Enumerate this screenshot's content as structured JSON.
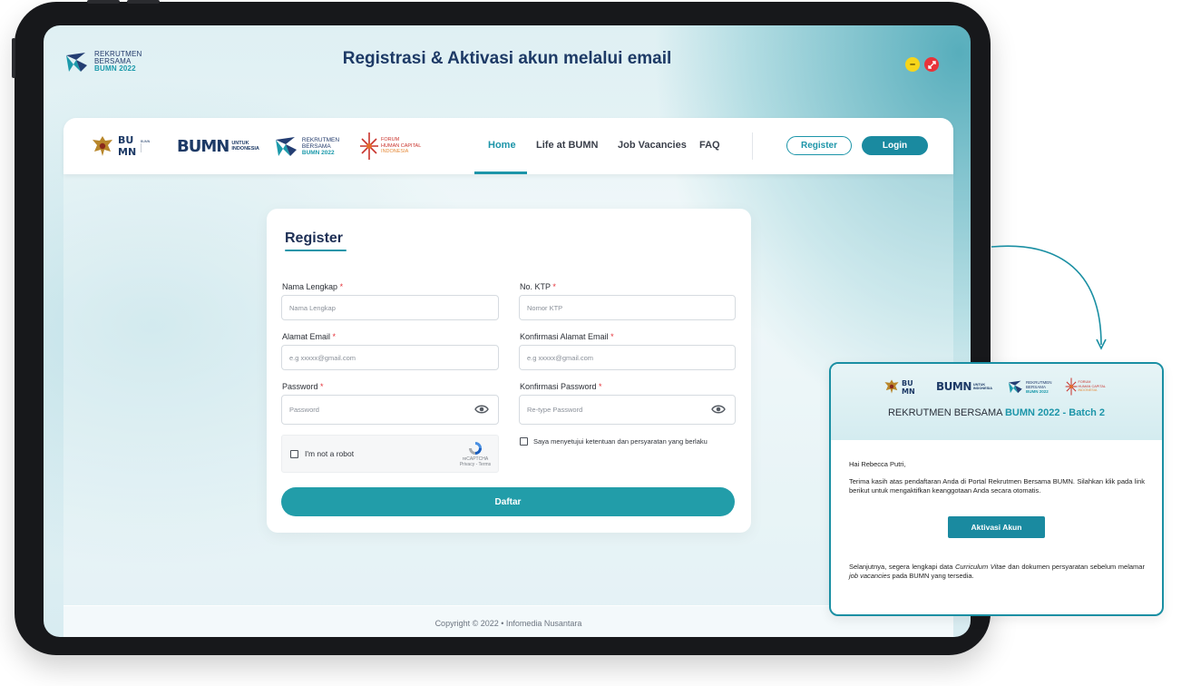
{
  "screen": {
    "title": "Registrasi & Aktivasi akun melalui email",
    "logo_line1": "REKRUTMEN",
    "logo_line2": "BERSAMA",
    "logo_line3": "BUMN 2022",
    "window_min_icon": "minimize-icon",
    "window_close_icon": "close-icon"
  },
  "navbar": {
    "logos": {
      "bumn_small_caption": "BUMN",
      "bumn_brand": "BUMN",
      "bumn_tagline_1": "UNTUK",
      "bumn_tagline_2": "INDONESIA",
      "rekrutmen_1": "REKRUTMEN",
      "rekrutmen_2": "BERSAMA",
      "rekrutmen_3": "BUMN 2022",
      "forum_1": "FORUM",
      "forum_2": "HUMAN CAPITAL",
      "forum_3": "INDONESIA"
    },
    "items": [
      {
        "label": "Home",
        "active": true
      },
      {
        "label": "Life at BUMN",
        "active": false
      },
      {
        "label": "Job Vacancies",
        "active": false
      },
      {
        "label": "FAQ",
        "active": false
      }
    ],
    "register_label": "Register",
    "login_label": "Login"
  },
  "form": {
    "title": "Register",
    "fields": {
      "nama": {
        "label": "Nama Lengkap",
        "required": "*",
        "placeholder": "Nama Lengkap"
      },
      "ktp": {
        "label": "No. KTP",
        "required": "*",
        "placeholder": "Nomor KTP"
      },
      "email": {
        "label": "Alamat Email",
        "required": "*",
        "placeholder": "e.g xxxxx@gmail.com"
      },
      "email_confirm": {
        "label": "Konfirmasi Alamat Email",
        "required": "*",
        "placeholder": "e.g xxxxx@gmail.com"
      },
      "password": {
        "label": "Password",
        "required": "*",
        "placeholder": "Password"
      },
      "password_confirm": {
        "label": "Konfirmasi Password",
        "required": "*",
        "placeholder": "Re-type Password"
      }
    },
    "captcha": {
      "label": "I'm not a robot",
      "brand": "reCAPTCHA",
      "links": "Privacy - Terms"
    },
    "agree_label": "Saya menyetujui ketentuan dan persyaratan yang berlaku",
    "submit_label": "Daftar"
  },
  "footer": {
    "copyright": "Copyright © 2022 • Infomedia Nusantara"
  },
  "email": {
    "title_prefix": "REKRUTMEN BERSAMA ",
    "title_highlight": "BUMN 2022 - Batch 2",
    "greeting": "Hai Rebecca Putri,",
    "body": "Terima kasih atas pendaftaran Anda di Portal Rekrutmen Bersama BUMN. Silahkan klik pada link berikut untuk mengaktifkan keanggotaan Anda secara otomatis.",
    "button_label": "Aktivasi Akun",
    "footer_1": "Selanjutnya, segera lengkapi data ",
    "footer_cv": "Curriculum Vitae",
    "footer_2": " dan dokumen persyaratan sebelum melamar ",
    "footer_jobs": "job vacancies",
    "footer_3": " pada BUMN yang tersedia."
  },
  "colors": {
    "accent": "#1c95a9",
    "navy": "#1d3a66",
    "required": "#e5333a"
  }
}
